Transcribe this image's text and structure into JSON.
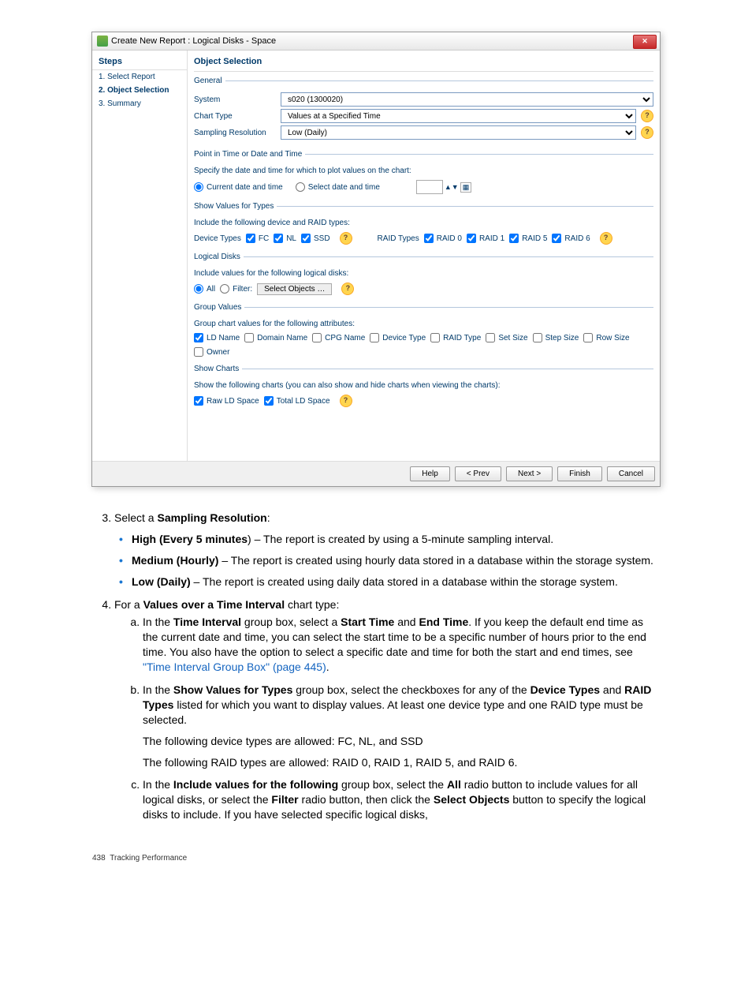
{
  "titlebar": {
    "text": "Create New Report : Logical Disks - Space",
    "close": "✕"
  },
  "steps": {
    "header": "Steps",
    "items": [
      "1. Select Report",
      "2. Object Selection",
      "3. Summary"
    ]
  },
  "content_header": "Object Selection",
  "general": {
    "legend": "General",
    "system_label": "System",
    "system_value": "s020 (1300020)",
    "chart_type_label": "Chart Type",
    "chart_type_value": "Values at a Specified Time",
    "sampling_label": "Sampling Resolution",
    "sampling_value": "Low (Daily)"
  },
  "pit": {
    "legend": "Point in Time or Date and Time",
    "desc": "Specify the date and time for which to plot values on the chart:",
    "opt_current": "Current date and time",
    "opt_select": "Select date and time"
  },
  "types": {
    "legend": "Show Values for Types",
    "desc": "Include the following device and RAID types:",
    "dev_label": "Device Types",
    "dev": [
      "FC",
      "NL",
      "SSD"
    ],
    "raid_label": "RAID Types",
    "raid": [
      "RAID 0",
      "RAID 1",
      "RAID 5",
      "RAID 6"
    ]
  },
  "ld": {
    "legend": "Logical Disks",
    "desc": "Include values for the following logical disks:",
    "opt_all": "All",
    "opt_filter": "Filter:",
    "select_btn": "Select Objects …"
  },
  "group": {
    "legend": "Group Values",
    "desc": "Group chart values for the following attributes:",
    "attrs": [
      "LD Name",
      "Domain Name",
      "CPG Name",
      "Device Type",
      "RAID Type",
      "Set Size",
      "Step Size",
      "Row Size",
      "Owner"
    ]
  },
  "charts": {
    "legend": "Show Charts",
    "desc": "Show the following charts (you can also show and hide charts when viewing the charts):",
    "items": [
      "Raw LD Space",
      "Total LD Space"
    ]
  },
  "footer_buttons": [
    "Help",
    "< Prev",
    "Next >",
    "Finish",
    "Cancel"
  ],
  "instr": {
    "step3_lead": "Sampling Resolution",
    "step3_pre": "Select a ",
    "b1_strong": "High (Every 5 minutes",
    "b1_rest": ") – The report is created by using a 5-minute sampling interval.",
    "b2_strong": "Medium (Hourly)",
    "b2_rest": " – The report is created using hourly data stored in a database within the storage system.",
    "b3_strong": "Low (Daily)",
    "b3_rest": " – The report is created using daily data stored in a database within the storage system.",
    "step4_pre": "For a ",
    "step4_strong": "Values over a Time Interval",
    "step4_post": " chart type:",
    "a_p": "In the ",
    "a_ti": "Time Interval",
    "a_mid1": " group box, select a ",
    "a_st": "Start Time",
    "a_and": " and ",
    "a_et": "End Time",
    "a_rest": ". If you keep the default end time as the current date and time, you can select the start time to be a specific number of hours prior to the end time. You also have the option to select a specific date and time for both the start and end times, see ",
    "a_link": "\"Time Interval Group Box\" (page 445)",
    "a_dot": ".",
    "b_p": "In the ",
    "b_sv": "Show Values for Types",
    "b_mid": " group box, select the checkboxes for any of the ",
    "b_dt": "Device Types",
    "b_and": " and ",
    "b_rt": "RAID Types",
    "b_rest": " listed for which you want to display values. At least one device type and one RAID type must be selected.",
    "b_line2": "The following device types are allowed: FC, NL, and SSD",
    "b_line3": "The following RAID types are allowed: RAID 0, RAID 1, RAID 5, and RAID 6.",
    "c_p": "In the ",
    "c_iv": "Include values for the following",
    "c_mid1": " group box, select the ",
    "c_all": "All",
    "c_mid2": " radio button to include values for all logical disks, or select the ",
    "c_filter": "Filter",
    "c_mid3": " radio button, then click the ",
    "c_so": "Select Objects",
    "c_rest": " button to specify the logical disks to include. If you have selected specific logical disks,"
  },
  "page_number": "438",
  "page_section": "Tracking Performance"
}
